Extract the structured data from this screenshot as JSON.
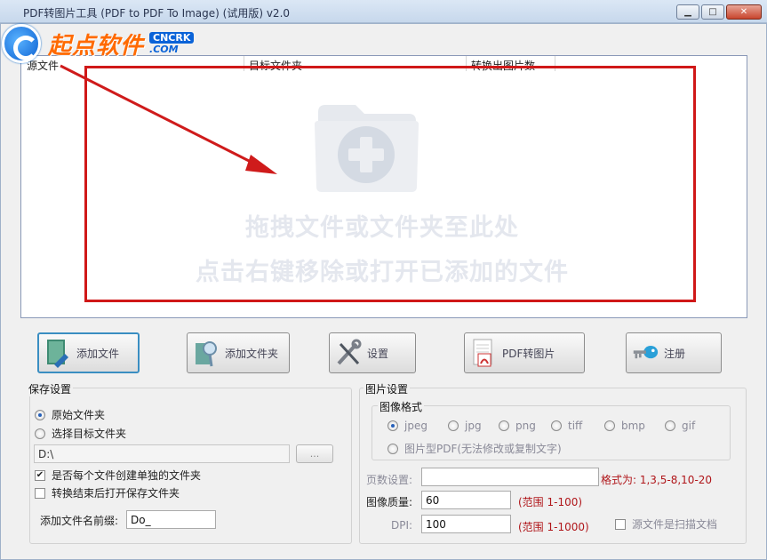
{
  "window": {
    "title": "PDF转图片工具 (PDF to PDF To Image) (试用版) v2.0",
    "minimize_icon": "minimize-icon",
    "maximize_icon": "maximize-icon",
    "close_icon": "close-icon"
  },
  "watermark": {
    "brand": "起点软件",
    "badge": "CNCRK",
    "domain": ".COM"
  },
  "file_list": {
    "columns": [
      "源文件",
      "目标文件夹",
      "转换出图片数"
    ],
    "empty_line1": "拖拽文件或文件夹至此处",
    "empty_line2": "点击右键移除或打开已添加的文件"
  },
  "toolbar": {
    "add_file": "添加文件",
    "add_folder": "添加文件夹",
    "settings": "设置",
    "convert": "PDF转图片",
    "register": "注册"
  },
  "save_settings": {
    "title": "保存设置",
    "option_original": "原始文件夹",
    "option_target": "选择目标文件夹",
    "path_value": "D:\\",
    "browse_label": "...",
    "create_subfolder": "是否每个文件创建单独的文件夹",
    "open_after": "转换结束后打开保存文件夹",
    "prefix_label": "添加文件名前缀:",
    "prefix_value": "Do_"
  },
  "image_settings": {
    "title": "图片设置",
    "format_title": "图像格式",
    "formats": [
      "jpeg",
      "jpg",
      "png",
      "tiff",
      "bmp",
      "gif"
    ],
    "selected_format": "jpeg",
    "image_pdf": "图片型PDF(无法修改或复制文字)",
    "pages_label": "页数设置:",
    "pages_value": "",
    "pages_hint": "格式为: 1,3,5-8,10-20",
    "quality_label": "图像质量:",
    "quality_value": "60",
    "quality_hint": "(范围 1-100)",
    "dpi_label": "DPI:",
    "dpi_value": "100",
    "dpi_hint": "(范围 1-1000)",
    "scanned_label": "源文件是扫描文档"
  }
}
